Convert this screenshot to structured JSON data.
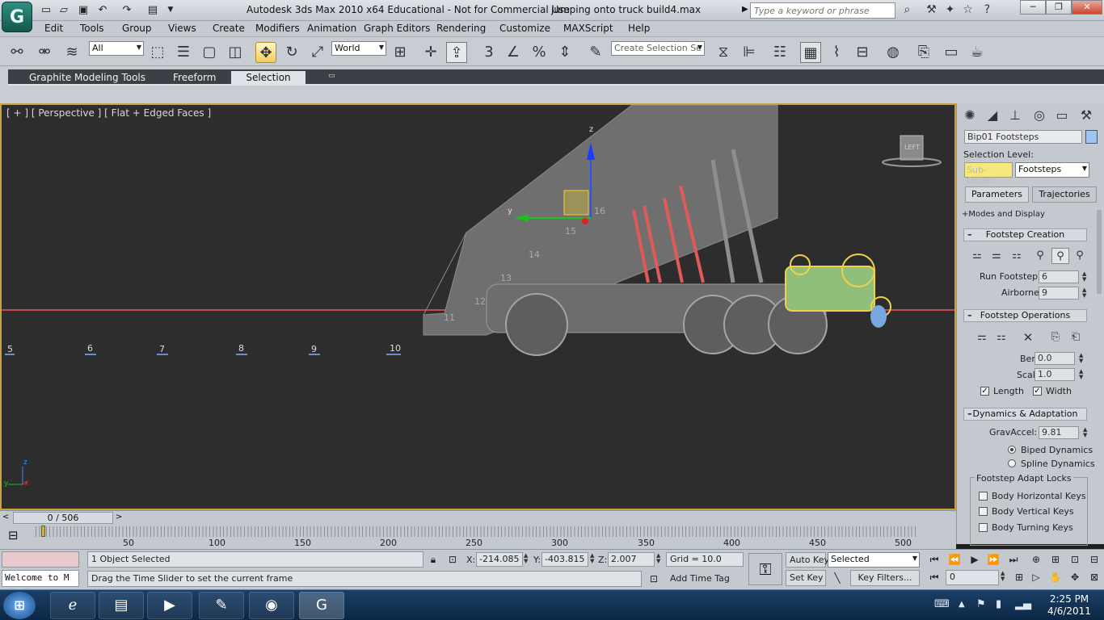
{
  "window": {
    "title": "Autodesk 3ds Max  2010 x64   Educational - Not for Commercial Use",
    "file": "jumping onto truck build4.max",
    "search_placeholder": "Type a keyword or phrase",
    "app_logo": "G"
  },
  "menu": [
    "Edit",
    "Tools",
    "Group",
    "Views",
    "Create",
    "Modifiers",
    "Animation",
    "Graph Editors",
    "Rendering",
    "Customize",
    "MAXScript",
    "Help"
  ],
  "toolbar": {
    "filter_value": "All",
    "coord_value": "World",
    "named_selection_placeholder": "Create Selection Se"
  },
  "ribbon": {
    "tabs": [
      "Graphite Modeling Tools",
      "Freeform",
      "Selection"
    ],
    "selected_tab": "Selection"
  },
  "viewport": {
    "label": "[ + ] [ Perspective ] [ Flat + Edged Faces ]",
    "gizmo": {
      "z": "z",
      "y": "y"
    },
    "cube_label": "LEFT",
    "footstep_numbers": [
      "5",
      "6",
      "7",
      "8",
      "9",
      "10"
    ],
    "ramp_numbers": [
      "16",
      "15",
      "14",
      "13",
      "12",
      "11"
    ],
    "axis_mini": {
      "z": "z",
      "y": "y",
      "x": "x"
    }
  },
  "command_panel": {
    "object_name": "Bip01 Footsteps",
    "selection_level_label": "Selection Level:",
    "sub_object": "Sub-Object",
    "selection_level_value": "Footsteps",
    "tabs": [
      "Parameters",
      "Trajectories"
    ],
    "modes_display": "Modes and Display",
    "footstep_creation": {
      "title": "Footstep Creation",
      "run_footstep_label": "Run Footstep",
      "run_footstep_value": "6",
      "airborne_label": "Airborne",
      "airborne_value": "9"
    },
    "footstep_operations": {
      "title": "Footstep Operations",
      "bend_label": "Bend:",
      "bend_value": "0.0",
      "scale_label": "Scale:",
      "scale_value": "1.0",
      "length_label": "Length",
      "width_label": "Width"
    },
    "dynamics": {
      "title": "Dynamics & Adaptation",
      "gravaccel_label": "GravAccel:",
      "gravaccel_value": "9.81",
      "biped_dynamics": "Biped Dynamics",
      "spline_dynamics": "Spline Dynamics",
      "adapt_locks_title": "Footstep Adapt Locks",
      "locks": [
        "Body Horizontal Keys",
        "Body Vertical Keys",
        "Body Turning Keys"
      ]
    }
  },
  "timeline": {
    "slider_label": "0 / 506",
    "current_frame": 0,
    "total_frames": 506,
    "ticks": [
      "50",
      "100",
      "150",
      "200",
      "250",
      "300",
      "350",
      "400",
      "450",
      "500"
    ]
  },
  "status": {
    "maxscript_listener": "Welcome to M",
    "selection_info": "1 Object Selected",
    "prompt": "Drag the Time Slider to set the current frame",
    "x_label": "X:",
    "x_value": "-214.085",
    "y_label": "Y:",
    "y_value": "-403.815",
    "z_label": "Z:",
    "z_value": "2.007",
    "grid": "Grid = 10.0",
    "add_time_tag": "Add Time Tag",
    "auto_key": "Auto Key",
    "set_key": "Set Key",
    "selected_value": "Selected",
    "key_filters": "Key Filters...",
    "frame_value": "0"
  },
  "taskbar": {
    "time": "2:25 PM",
    "date": "4/6/2011"
  }
}
